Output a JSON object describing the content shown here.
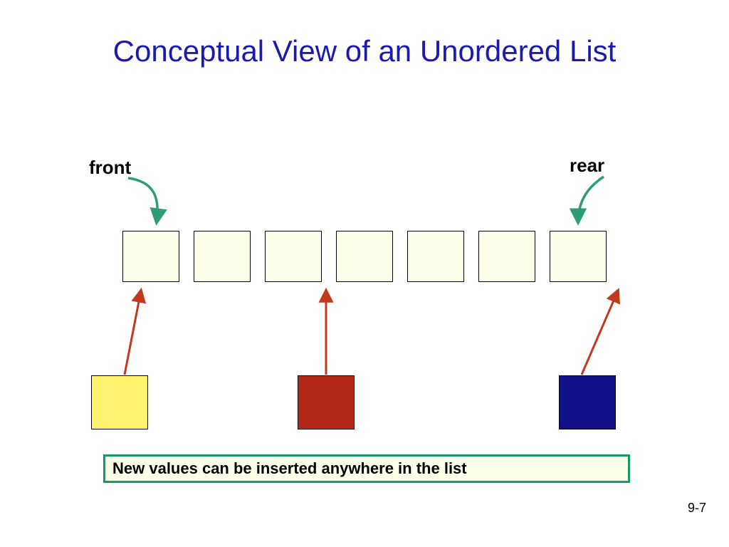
{
  "title": "Conceptual View of an Unordered List",
  "labels": {
    "front": "front",
    "rear": "rear"
  },
  "caption": "New values can be inserted anywhere in the list",
  "page_number": "9-7",
  "colors": {
    "title": "#1a1aaf",
    "caption_border": "#169a6a",
    "list_box_fill": "#feffe8",
    "arrow_green": "#2e9d76",
    "arrow_red": "#c23a1b",
    "insert_yellow": "#fef270",
    "insert_red": "#b42918",
    "insert_blue": "#121086"
  },
  "list_box_count": 7,
  "insert_boxes": [
    {
      "name": "yellow-box",
      "color": "insert_yellow"
    },
    {
      "name": "red-box",
      "color": "insert_red"
    },
    {
      "name": "blue-box",
      "color": "insert_blue"
    }
  ]
}
